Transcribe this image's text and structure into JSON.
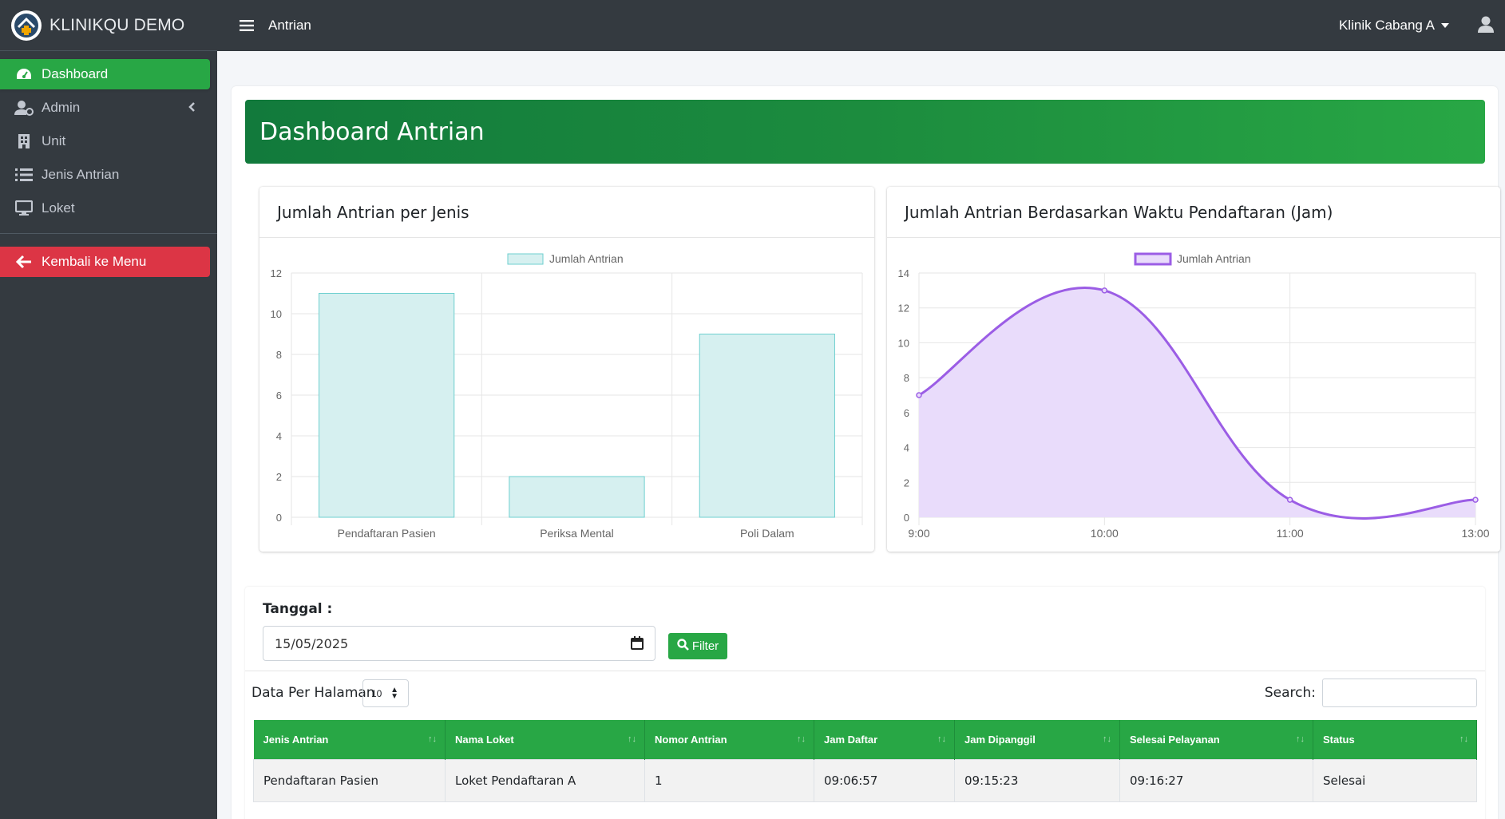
{
  "brand": {
    "name": "KLINIKQU DEMO"
  },
  "sidebar": {
    "items": [
      {
        "label": "Dashboard",
        "icon": "dashboard-gauge-icon",
        "active": true
      },
      {
        "label": "Admin",
        "icon": "user-cog-icon",
        "has_children": true
      },
      {
        "label": "Unit",
        "icon": "building-icon"
      },
      {
        "label": "Jenis Antrian",
        "icon": "list-icon"
      },
      {
        "label": "Loket",
        "icon": "monitor-icon"
      }
    ],
    "back_button": {
      "label": "Kembali ke Menu",
      "icon": "arrow-left-icon"
    }
  },
  "topbar": {
    "title": "Antrian",
    "branch": "Klinik Cabang A",
    "user_icon": "user-icon"
  },
  "hero": {
    "title": "Dashboard Antrian"
  },
  "colors": {
    "sidebar": "#343a40",
    "accent": "#28a745",
    "danger": "#dc3545",
    "bar_fill": "#d6f0f0",
    "bar_stroke": "#6ecfcf",
    "line": "#9b5de5",
    "area_fill": "#e9dcfb"
  },
  "chart_data": [
    {
      "type": "bar",
      "title": "Jumlah Antrian per Jenis",
      "categories": [
        "Pendaftaran Pasien",
        "Periksa Mental",
        "Poli Dalam"
      ],
      "series": [
        {
          "name": "Jumlah Antrian",
          "values": [
            11,
            2,
            9
          ]
        }
      ],
      "ylim": [
        0,
        12
      ],
      "yticks": [
        "0",
        "2",
        "4",
        "6",
        "8",
        "10",
        "12"
      ],
      "legend": "top",
      "grid": true
    },
    {
      "type": "area",
      "title": "Jumlah Antrian Berdasarkan Waktu Pendaftaran (Jam)",
      "categories": [
        "9:00",
        "10:00",
        "11:00",
        "13:00"
      ],
      "series": [
        {
          "name": "Jumlah Antrian",
          "values": [
            7,
            13,
            1,
            1
          ]
        }
      ],
      "ylim": [
        0,
        14
      ],
      "yticks": [
        "0",
        "2",
        "4",
        "6",
        "8",
        "10",
        "12",
        "14"
      ],
      "legend": "top",
      "grid": true
    }
  ],
  "filter": {
    "label": "Tanggal :",
    "date_value": "15/05/2025",
    "button_label": "Filter"
  },
  "table_controls": {
    "length_label": "Data Per Halaman",
    "length_value": "10",
    "search_label": "Search:"
  },
  "table": {
    "columns": [
      "Jenis Antrian",
      "Nama Loket",
      "Nomor Antrian",
      "Jam Daftar",
      "Jam Dipanggil",
      "Selesai Pelayanan",
      "Status"
    ],
    "rows": [
      [
        "Pendaftaran Pasien",
        "Loket Pendaftaran A",
        "1",
        "09:06:57",
        "09:15:23",
        "09:16:27",
        "Selesai"
      ]
    ]
  }
}
